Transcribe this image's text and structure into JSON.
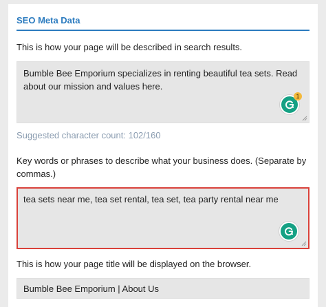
{
  "seo": {
    "section_title": "SEO Meta Data",
    "description_label": "This is how your page will be described in search results.",
    "description_value": "Bumble Bee Emporium specializes in renting beautiful tea sets. Read about our mission and values here.",
    "character_hint": "Suggested character count: 102/160",
    "keywords_label": "Key words or phrases to describe what your business does. (Separate by commas.)",
    "keywords_value": "tea sets near me, tea set rental, tea set, tea party rental near me",
    "title_label": "This is how your page title will be displayed on the browser.",
    "title_value": "Bumble Bee Emporium | About Us",
    "grammarly_badge_count": "1"
  },
  "colors": {
    "accent": "#2b7bbf",
    "focus_border": "#d9413a",
    "grammarly": "#15a184",
    "badge": "#f4b93b",
    "hint_text": "#8a9cb0"
  },
  "icons": [
    "grammarly-icon",
    "resize-handle-icon"
  ]
}
